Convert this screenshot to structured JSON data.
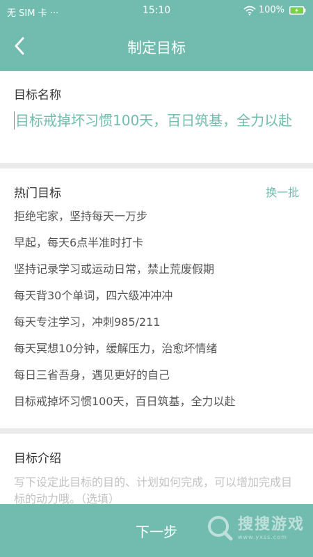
{
  "status_bar": {
    "carrier": "无 SIM 卡 ···",
    "time": "15:10",
    "battery": "100%"
  },
  "header": {
    "title": "制定目标",
    "back_icon": "chevron-left-icon"
  },
  "goal_name": {
    "label": "目标名称",
    "value": "目标戒掉坏习惯100天，百日筑基，全力以赴"
  },
  "hot_goals": {
    "label": "热门目标",
    "refresh_label": "换一批",
    "items": [
      "拒绝宅家，坚持每天一万步",
      "早起，每天6点半准时打卡",
      "坚持记录学习或运动日常，禁止荒废假期",
      "每天背30个单词，四六级冲冲冲",
      "每天专注学习，冲刺985/211",
      "每天冥想10分钟，缓解压力，治愈坏情绪",
      "每日三省吾身，遇见更好的自己",
      "目标戒掉坏习惯100天，百日筑基，全力以赴"
    ]
  },
  "intro": {
    "label": "目标介绍",
    "placeholder": "写下设定此目标的目的、计划如何完成，可以增加完成目标的动力哦。（选填）"
  },
  "footer": {
    "next_label": "下一步"
  },
  "watermark": {
    "text": "搜搜游戏",
    "url": "www.yxss.com"
  },
  "colors": {
    "accent": "#71bcae",
    "background": "#ebebeb",
    "placeholder": "#c2c2c2"
  }
}
